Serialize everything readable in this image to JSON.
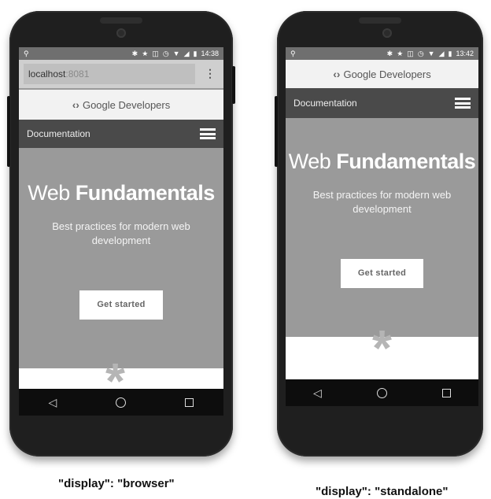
{
  "phones": [
    {
      "status_time": "14:38",
      "address_host": "localhost",
      "address_port": ":8081",
      "brand": "Google Developers",
      "nav_label": "Documentation",
      "hero_title_light": "Web",
      "hero_title_bold": "Fundamentals",
      "hero_subtitle": "Best practices for modern web development",
      "cta_label": "Get started",
      "caption": "\"display\": \"browser\""
    },
    {
      "status_time": "13:42",
      "brand": "Google Developers",
      "nav_label": "Documentation",
      "hero_title_light": "Web",
      "hero_title_bold": "Fundamentals",
      "hero_subtitle": "Best practices for modern web development",
      "cta_label": "Get started",
      "caption": "\"display\": \"standalone\""
    }
  ],
  "icons": {
    "logo": "google-developers-logo-icon",
    "menu": "hamburger-menu-icon",
    "overflow": "overflow-menu-icon",
    "back": "back-triangle-icon",
    "home": "home-circle-icon",
    "recents": "recents-square-icon",
    "decor": "asterisk-icon"
  },
  "colors": {
    "hero_bg": "#9a9a9a",
    "nav_bg": "#4a4a4a",
    "brand_bar_bg": "#f2f2f2",
    "system_nav_bg": "#0d0d0d"
  }
}
